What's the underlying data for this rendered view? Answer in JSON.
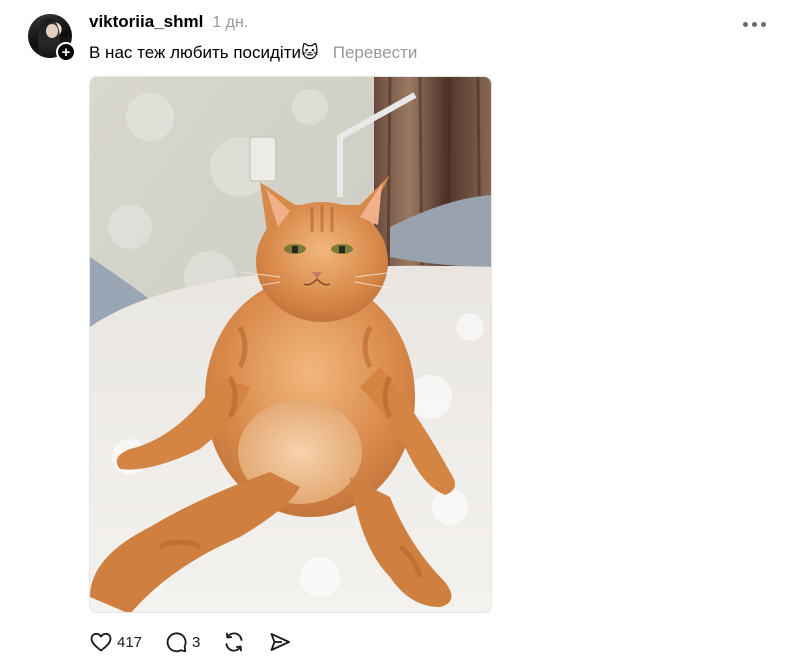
{
  "post": {
    "author": {
      "username": "viktoriia_shml",
      "follow_badge": "+"
    },
    "timestamp": "1 дн.",
    "caption": "В нас теж любить посидіти🐱",
    "translate_label": "Перевести",
    "more_icon": "ellipsis-icon",
    "image": {
      "icon": "photo-cat"
    },
    "actions": {
      "likes": "417",
      "comments": "3"
    }
  }
}
